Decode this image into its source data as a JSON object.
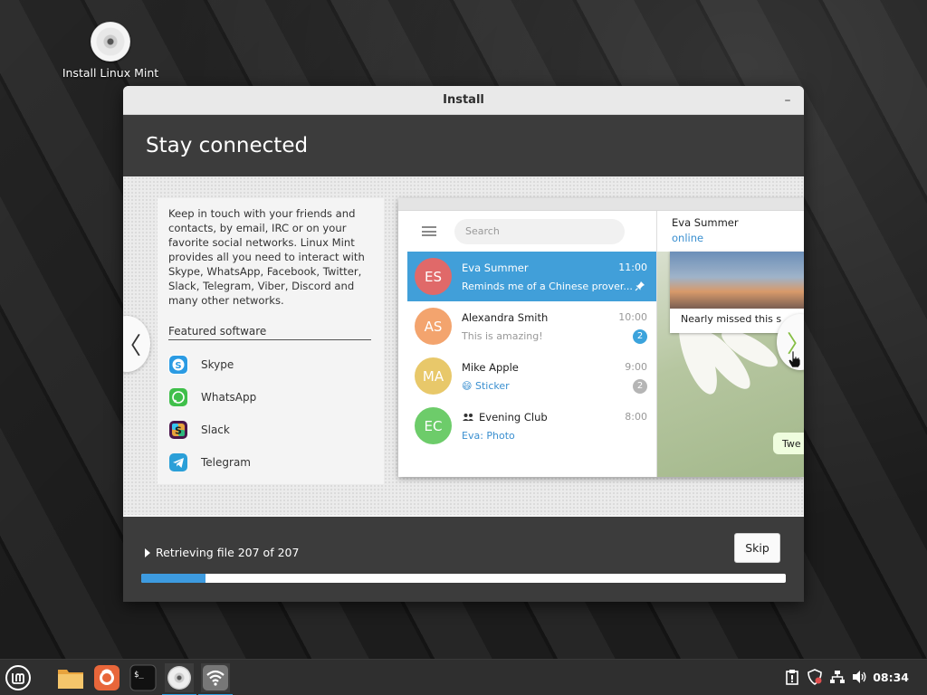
{
  "desktop": {
    "icon_label": "Install Linux Mint"
  },
  "window": {
    "title": "Install",
    "minimize_symbol": "–"
  },
  "page": {
    "heading": "Stay connected",
    "description": "Keep in touch with your friends and contacts, by email, IRC or on your favorite social networks. Linux Mint provides all you need to interact with Skype, WhatsApp, Facebook, Twitter, Slack, Telegram, Viber, Discord and many other networks.",
    "featured_heading": "Featured software",
    "software": [
      {
        "label": "Skype",
        "icon": "skype-icon",
        "color": "#2b9be3"
      },
      {
        "label": "WhatsApp",
        "icon": "whatsapp-icon",
        "color": "#3fbf4a"
      },
      {
        "label": "Slack",
        "icon": "slack-icon",
        "color": "#4a154b"
      },
      {
        "label": "Telegram",
        "icon": "telegram-icon",
        "color": "#2a9fd8"
      }
    ],
    "prev_symbol": "〈",
    "next_symbol": "〉"
  },
  "telegram_mock": {
    "search_placeholder": "Search",
    "chats": [
      {
        "initials": "ES",
        "name": "Eva Summer",
        "time": "11:00",
        "message": "Reminds me of a Chinese prover...",
        "avatar_color": "#e06969",
        "pinned": true
      },
      {
        "initials": "AS",
        "name": "Alexandra Smith",
        "time": "10:00",
        "message": "This is amazing!",
        "avatar_color": "#f3a46e",
        "badge": "2",
        "badge_color": "#3ba3dc"
      },
      {
        "initials": "MA",
        "name": "Mike Apple",
        "time": "9:00",
        "message": "😄 Sticker",
        "avatar_color": "#e8c86a",
        "badge": "2",
        "badge_color": "#b5b5b5"
      },
      {
        "initials": "EC",
        "name": "Evening Club",
        "time": "8:00",
        "message": "Eva: Photo",
        "avatar_color": "#6dcc6a"
      }
    ],
    "pin_symbol": "📌",
    "contact_name": "Eva Summer",
    "contact_status": "online",
    "photo_caption": "Nearly missed this s",
    "bubble_text": "Twe"
  },
  "progress": {
    "status": "Retrieving file 207 of 207",
    "skip_label": "Skip",
    "fraction": 0.1
  },
  "taskbar": {
    "clock": "08:34",
    "apps": [
      "menu-icon",
      "files-icon",
      "firefox-icon",
      "terminal-icon",
      "installer-disc-icon",
      "network-manager-icon"
    ],
    "tray": [
      "clipboard-icon",
      "shield-icon",
      "network-icon",
      "volume-icon"
    ]
  }
}
